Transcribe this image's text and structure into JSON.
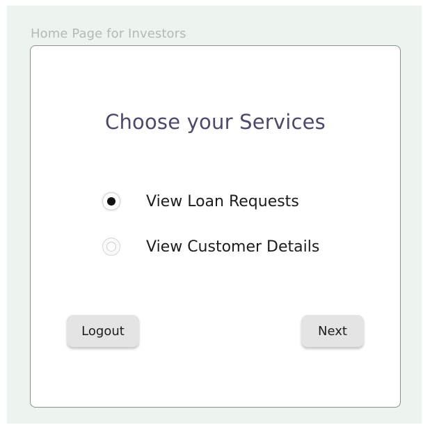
{
  "frame": {
    "label": "Home Page for Investors"
  },
  "card": {
    "title": "Choose your Services",
    "options": [
      {
        "label": "View Loan Requests",
        "selected": true
      },
      {
        "label": "View Customer Details",
        "selected": false
      }
    ],
    "buttons": {
      "logout": "Logout",
      "next": "Next"
    }
  },
  "colors": {
    "frame_background": "#edf4ef",
    "title_text": "#4a4a6e",
    "button_background": "#e4e4e4"
  }
}
